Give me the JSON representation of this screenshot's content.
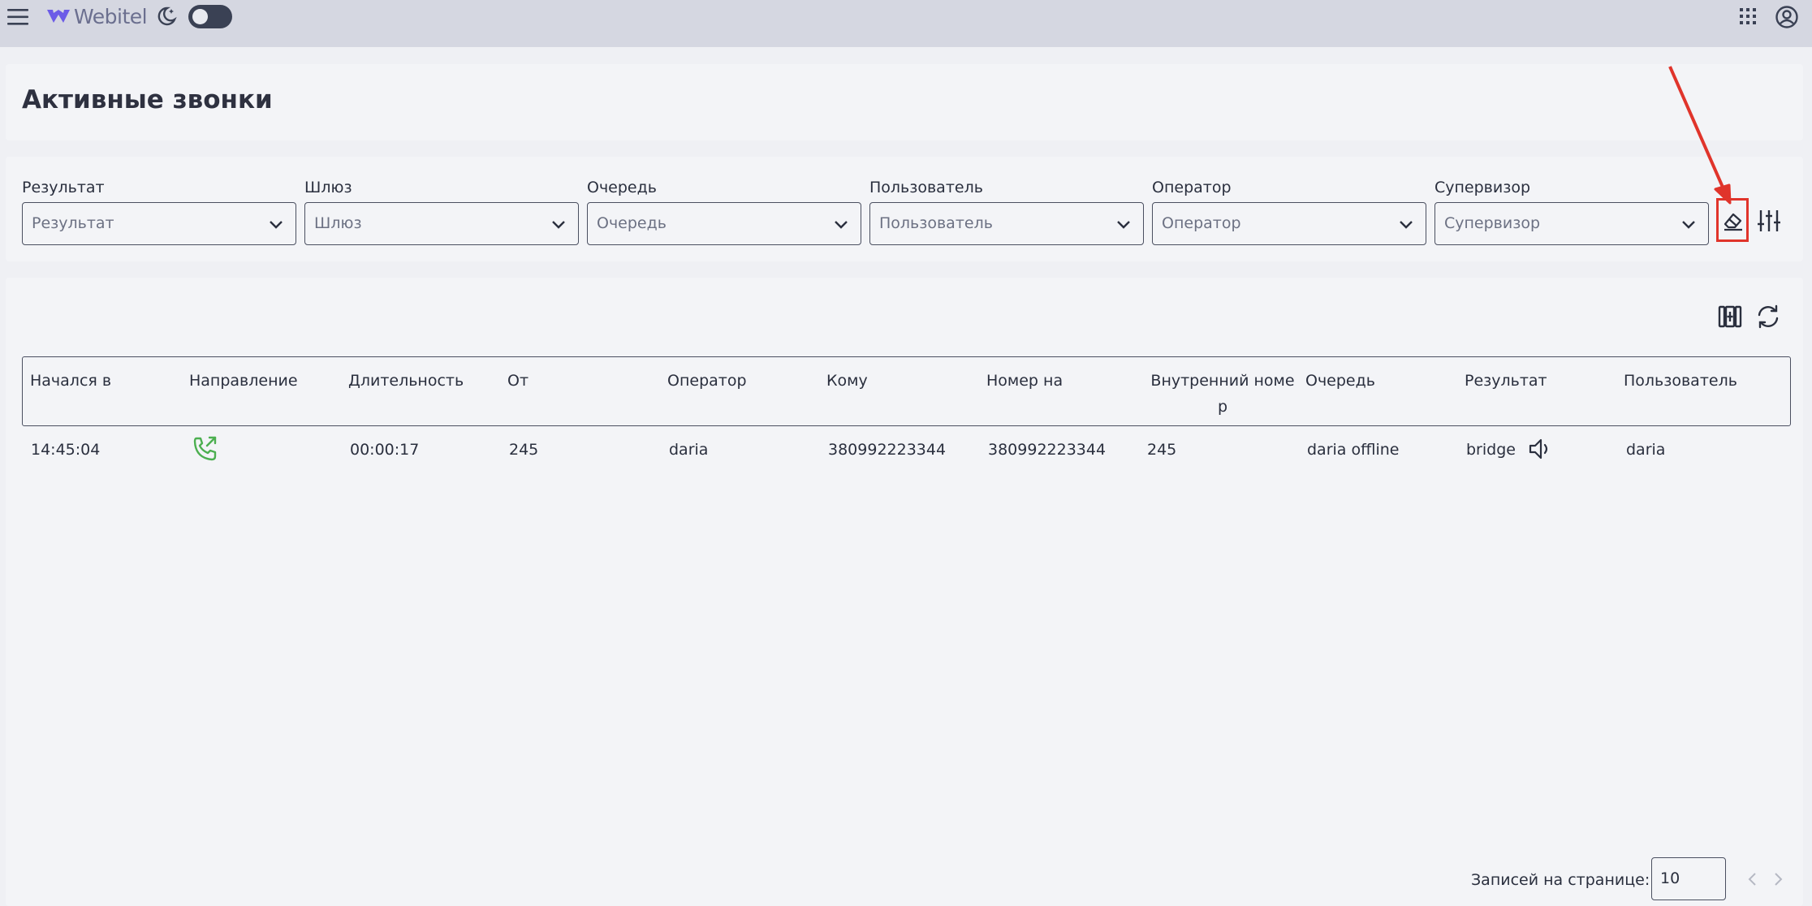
{
  "header": {
    "logo_text": "Webitel",
    "theme_toggle": "off"
  },
  "page": {
    "title": "Активные звонки"
  },
  "filters": [
    {
      "label": "Результат",
      "placeholder": "Результат"
    },
    {
      "label": "Шлюз",
      "placeholder": "Шлюз"
    },
    {
      "label": "Очередь",
      "placeholder": "Очередь"
    },
    {
      "label": "Пользователь",
      "placeholder": "Пользователь"
    },
    {
      "label": "Оператор",
      "placeholder": "Оператор"
    },
    {
      "label": "Супервизор",
      "placeholder": "Супервизор"
    }
  ],
  "table": {
    "columns": [
      "Начался в",
      "Направление",
      "Длительность",
      "От",
      "Оператор",
      "Кому",
      "Номер на",
      "Внутренний номе",
      "Очередь",
      "Результат",
      "Пользователь"
    ],
    "column_wrap": "р",
    "rows": [
      {
        "started_at": "14:45:04",
        "direction_icon": "phone-outbound-icon",
        "duration": "00:00:17",
        "from": "245",
        "operator": "daria",
        "to": "380992223344",
        "number_on": "380992223344",
        "extension": "245",
        "queue": "daria offline",
        "result": "bridge",
        "user": "daria"
      }
    ]
  },
  "pagination": {
    "label": "Записей на странице:",
    "per_page": "10"
  },
  "colors": {
    "accent": "#6c5ce7",
    "annotation": "#e0342b",
    "direction_icon": "#4caf50"
  }
}
